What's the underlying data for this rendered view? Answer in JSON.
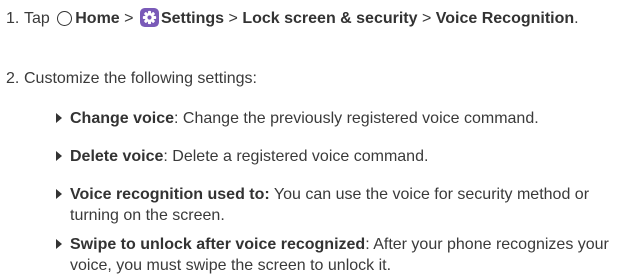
{
  "step1": {
    "number": "1.",
    "tap": "Tap",
    "home": "Home",
    "sep1": ">",
    "settings": "Settings",
    "sep2": ">",
    "lock": "Lock screen & security",
    "sep3": ">",
    "voice": "Voice Recognition",
    "end": "."
  },
  "step2": {
    "number": "2.",
    "text": "Customize the following settings:"
  },
  "bullets": [
    {
      "term": "Change voice",
      "desc": ": Change the previously registered voice command."
    },
    {
      "term": "Delete voice",
      "desc": ": Delete a registered voice command."
    },
    {
      "term": "Voice recognition used to:",
      "desc": " You can use the voice for security method or turning on the screen."
    },
    {
      "term": "Swipe to unlock after voice recognized",
      "desc": ": After your phone recognizes your voice, you must swipe the screen to unlock it."
    }
  ],
  "icons": {
    "home": "home-circle-icon",
    "settings": "settings-gear-icon",
    "settings_color": "#7a5ab8",
    "bullet": "triangle-bullet-icon"
  }
}
